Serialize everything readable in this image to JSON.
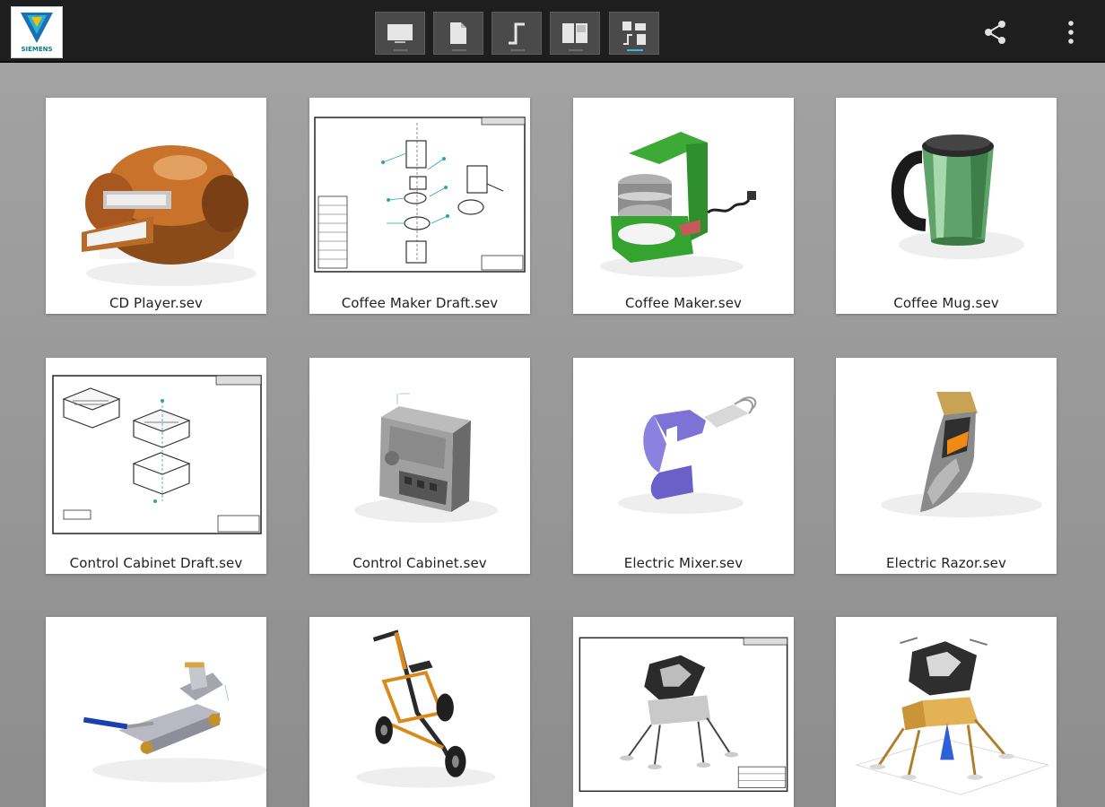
{
  "toolbar": {
    "logo_text": "SIEMENS",
    "buttons": [
      {
        "icon": "single-view-icon"
      },
      {
        "icon": "document-icon"
      },
      {
        "icon": "step-line-icon"
      },
      {
        "icon": "split-view-icon"
      },
      {
        "icon": "grid-view-icon",
        "active": true
      }
    ],
    "actions": [
      {
        "icon": "share-icon"
      },
      {
        "icon": "overflow-menu-icon"
      }
    ]
  },
  "files": [
    {
      "name": "CD Player.sev",
      "thumbnail": "cd-player-model"
    },
    {
      "name": "Coffee Maker Draft.sev",
      "thumbnail": "drawing-sheet"
    },
    {
      "name": "Coffee Maker.sev",
      "thumbnail": "coffee-maker-model"
    },
    {
      "name": "Coffee Mug.sev",
      "thumbnail": "coffee-mug-model"
    },
    {
      "name": "Control Cabinet Draft.sev",
      "thumbnail": "drawing-sheet"
    },
    {
      "name": "Control Cabinet.sev",
      "thumbnail": "control-cabinet-model"
    },
    {
      "name": "Electric Mixer.sev",
      "thumbnail": "electric-mixer-model"
    },
    {
      "name": "Electric Razor.sev",
      "thumbnail": "electric-razor-model"
    },
    {
      "name": "",
      "thumbnail": "floor-jack-model"
    },
    {
      "name": "",
      "thumbnail": "stroller-model"
    },
    {
      "name": "",
      "thumbnail": "lunar-lander-drawing"
    },
    {
      "name": "",
      "thumbnail": "lunar-lander-model"
    }
  ],
  "colors": {
    "toolbar": "#1e1e1e",
    "accent": "#33b5e5",
    "brand": "#009999"
  }
}
